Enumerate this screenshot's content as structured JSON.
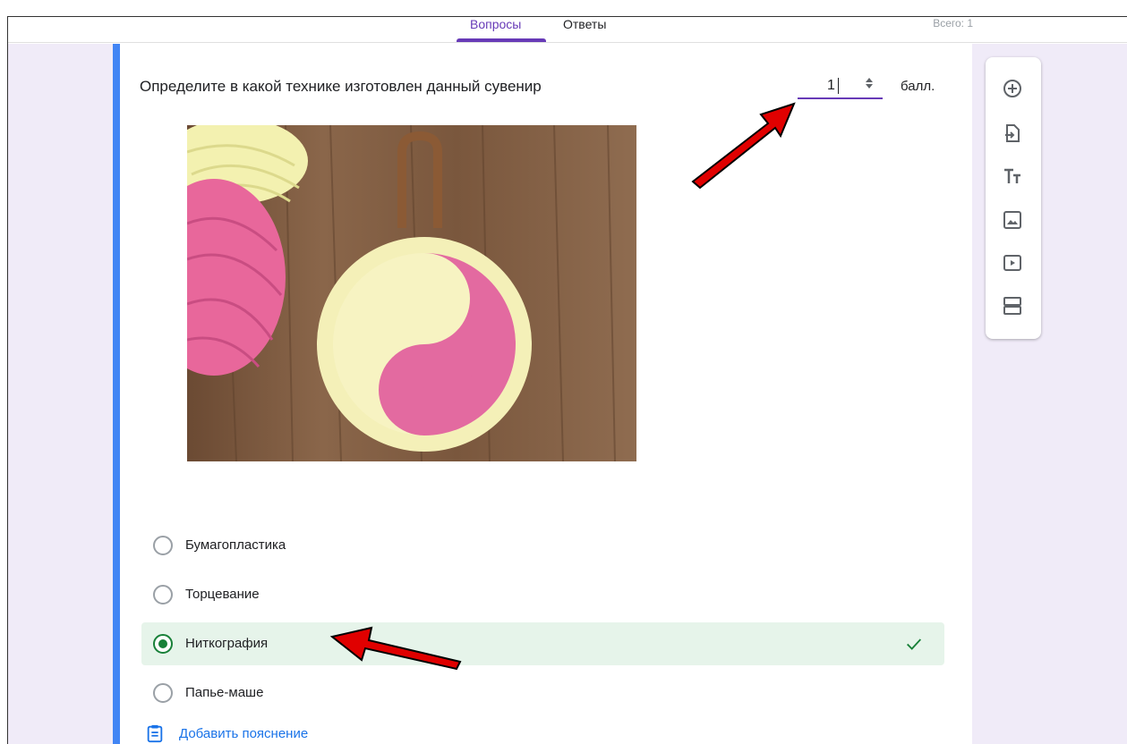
{
  "tabs": {
    "questions": "Вопросы",
    "answers": "Ответы",
    "total": "Всего: 1"
  },
  "question": {
    "title": "Определите в какой технике изготовлен данный сувенир",
    "points_value": "1",
    "points_unit": "балл.",
    "image_icon": "yarn-souvenir-photo"
  },
  "options": [
    {
      "label": "Бумагопластика",
      "checked": false,
      "correct": false
    },
    {
      "label": "Торцевание",
      "checked": false,
      "correct": false
    },
    {
      "label": "Ниткография",
      "checked": true,
      "correct": true
    },
    {
      "label": "Папье-маше",
      "checked": false,
      "correct": false
    }
  ],
  "explain_label": "Добавить пояснение",
  "toolbar_icons": [
    "add-question-icon",
    "import-questions-icon",
    "add-title-icon",
    "add-image-icon",
    "add-video-icon",
    "add-section-icon"
  ],
  "colors": {
    "accent": "#673ab7",
    "card_accent": "#4285f4",
    "correct_bg": "#e6f4ea",
    "correct_green": "#188038",
    "link_blue": "#1a73e8",
    "annotation_arrow": "#e00000"
  }
}
